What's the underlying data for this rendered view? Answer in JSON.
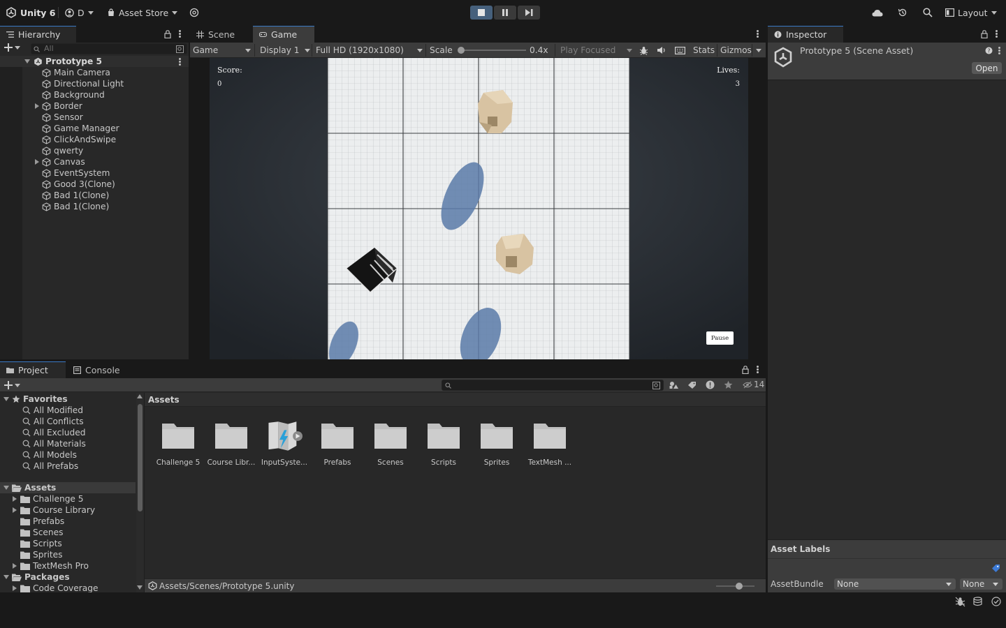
{
  "toolbar": {
    "app_name": "Unity 6",
    "account_label": "D",
    "asset_store_label": "Asset Store",
    "layout_label": "Layout"
  },
  "hierarchy": {
    "tab_label": "Hierarchy",
    "search_placeholder": "All",
    "scene_name": "Prototype 5",
    "items": [
      {
        "label": "Main Camera",
        "expandable": false
      },
      {
        "label": "Directional Light",
        "expandable": false
      },
      {
        "label": "Background",
        "expandable": false
      },
      {
        "label": "Border",
        "expandable": true
      },
      {
        "label": "Sensor",
        "expandable": false
      },
      {
        "label": "Game Manager",
        "expandable": false
      },
      {
        "label": "ClickAndSwipe",
        "expandable": false
      },
      {
        "label": "qwerty",
        "expandable": false
      },
      {
        "label": "Canvas",
        "expandable": true
      },
      {
        "label": "EventSystem",
        "expandable": false
      },
      {
        "label": "Good 3(Clone)",
        "expandable": false
      },
      {
        "label": "Bad 1(Clone)",
        "expandable": false
      },
      {
        "label": "Bad 1(Clone)",
        "expandable": false
      }
    ]
  },
  "center_tabs": {
    "scene_label": "Scene",
    "game_label": "Game"
  },
  "game_toolbar": {
    "mode": "Game",
    "display": "Display 1",
    "resolution": "Full HD (1920x1080)",
    "scale_label": "Scale",
    "scale_value": "0.4x",
    "scale_fraction": 0.02,
    "play_focused": "Play Focused",
    "stats": "Stats",
    "gizmos": "Gizmos"
  },
  "game_hud": {
    "score_label": "Score:",
    "score_value": "0",
    "lives_label": "Lives:",
    "lives_value": "3",
    "pause_button": "Pause"
  },
  "inspector": {
    "tab_label": "Inspector",
    "asset_title": "Prototype 5 (Scene Asset)",
    "open_button": "Open",
    "asset_labels_heading": "Asset Labels",
    "assetbundle_label": "AssetBundle",
    "assetbundle_value": "None",
    "assetbundle_variant": "None"
  },
  "bottom_tabs": {
    "project_label": "Project",
    "console_label": "Console"
  },
  "project": {
    "hidden_count": "14",
    "favorites_label": "Favorites",
    "favorites": [
      "All Modified",
      "All Conflicts",
      "All Excluded",
      "All Materials",
      "All Models",
      "All Prefabs"
    ],
    "assets_root": "Assets",
    "asset_folders": [
      {
        "label": "Challenge 5",
        "expandable": true
      },
      {
        "label": "Course Library",
        "expandable": true
      },
      {
        "label": "Prefabs",
        "expandable": false
      },
      {
        "label": "Scenes",
        "expandable": false
      },
      {
        "label": "Scripts",
        "expandable": false
      },
      {
        "label": "Sprites",
        "expandable": false
      },
      {
        "label": "TextMesh Pro",
        "expandable": true
      }
    ],
    "packages_root": "Packages",
    "package_folders": [
      {
        "label": "Code Coverage",
        "expandable": true
      }
    ],
    "breadcrumb": "Assets",
    "grid_items": [
      {
        "label": "Challenge 5",
        "icon": "folder-icon"
      },
      {
        "label": "Course Libr...",
        "icon": "folder-icon"
      },
      {
        "label": "InputSyste...",
        "icon": "input-system-icon"
      },
      {
        "label": "Prefabs",
        "icon": "folder-icon"
      },
      {
        "label": "Scenes",
        "icon": "folder-icon"
      },
      {
        "label": "Scripts",
        "icon": "folder-icon"
      },
      {
        "label": "Sprites",
        "icon": "folder-icon"
      },
      {
        "label": "TextMesh ...",
        "icon": "folder-icon"
      }
    ],
    "selected_path": "Assets/Scenes/Prototype 5.unity"
  },
  "colors": {
    "accent_blue": "#3a7ac6",
    "panel": "#282828",
    "toolbar": "#191919"
  }
}
